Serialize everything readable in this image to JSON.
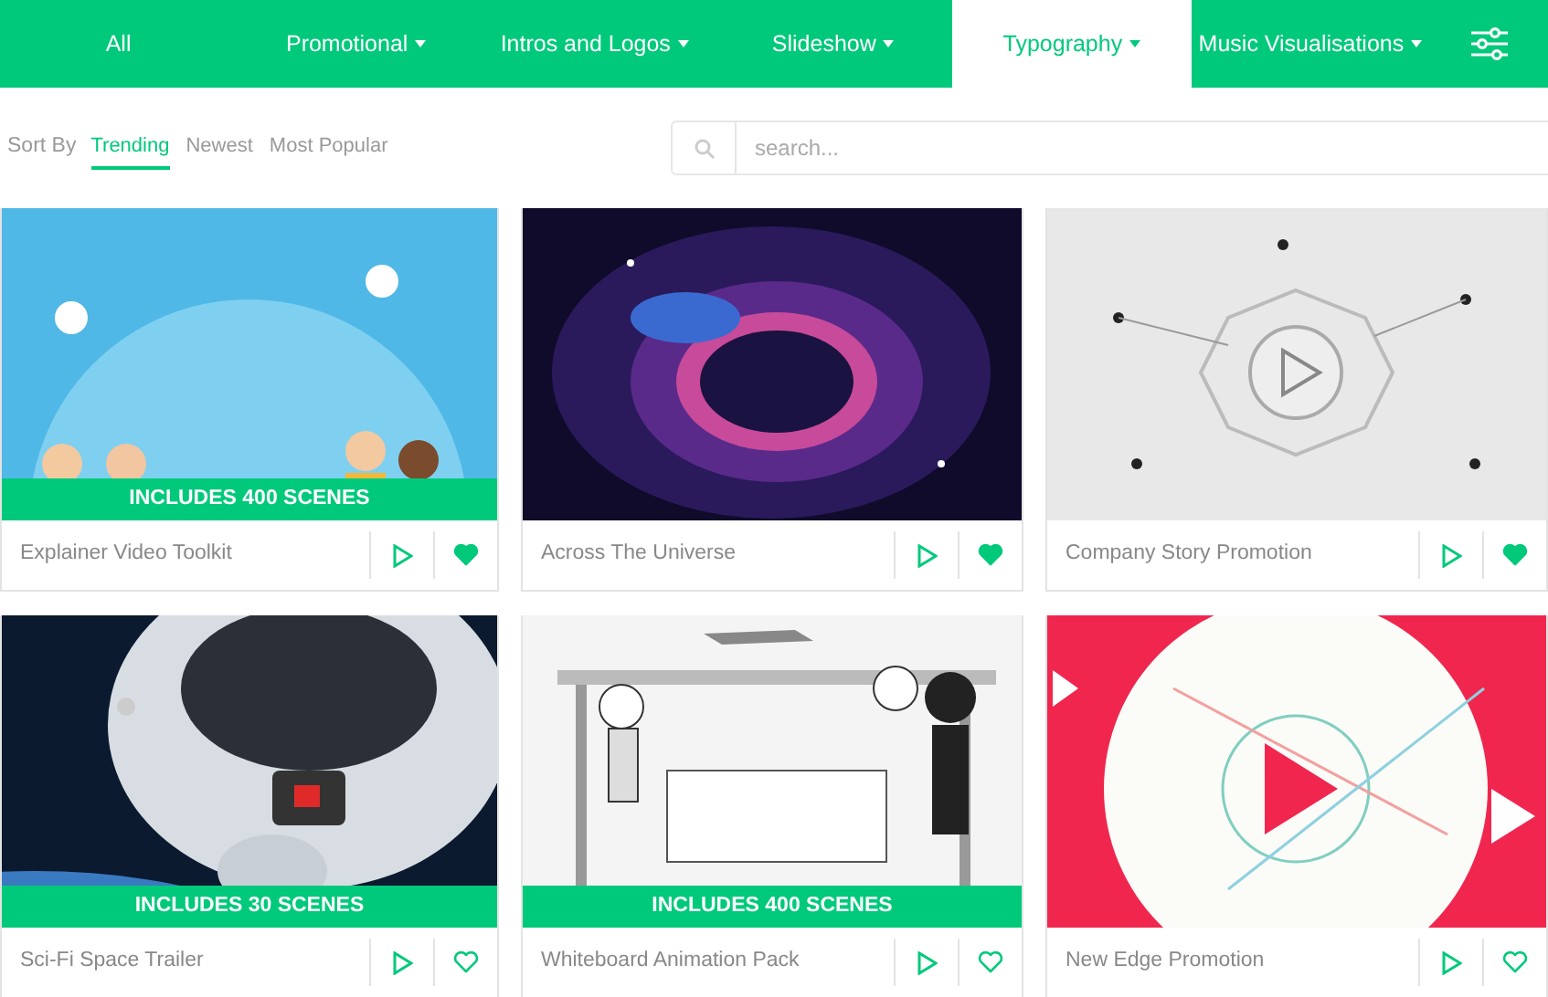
{
  "nav": {
    "tabs": [
      {
        "label": "All",
        "dropdown": false,
        "selected": false
      },
      {
        "label": "Promotional",
        "dropdown": true,
        "selected": false
      },
      {
        "label": "Intros and Logos",
        "dropdown": true,
        "selected": false
      },
      {
        "label": "Slideshow",
        "dropdown": true,
        "selected": false
      },
      {
        "label": "Typography",
        "dropdown": true,
        "selected": true
      },
      {
        "label": "Music Visualisations",
        "dropdown": true,
        "selected": false
      }
    ]
  },
  "sort": {
    "label": "Sort By",
    "options": [
      {
        "label": "Trending",
        "selected": true
      },
      {
        "label": "Newest",
        "selected": false
      },
      {
        "label": "Most Popular",
        "selected": false
      }
    ]
  },
  "search": {
    "placeholder": "search..."
  },
  "cards": [
    {
      "title": "Explainer Video Toolkit",
      "banner": "INCLUDES 400 SCENES",
      "favorite": true
    },
    {
      "title": "Across The Universe",
      "favorite": true
    },
    {
      "title": "Company Story Promotion",
      "favorite": true
    },
    {
      "title": "Sci-Fi Space Trailer",
      "banner": "INCLUDES 30 SCENES",
      "favorite": false
    },
    {
      "title": "Whiteboard Animation Pack",
      "banner": "INCLUDES 400 SCENES",
      "favorite": false
    },
    {
      "title": "New Edge Promotion",
      "favorite": false
    }
  ]
}
